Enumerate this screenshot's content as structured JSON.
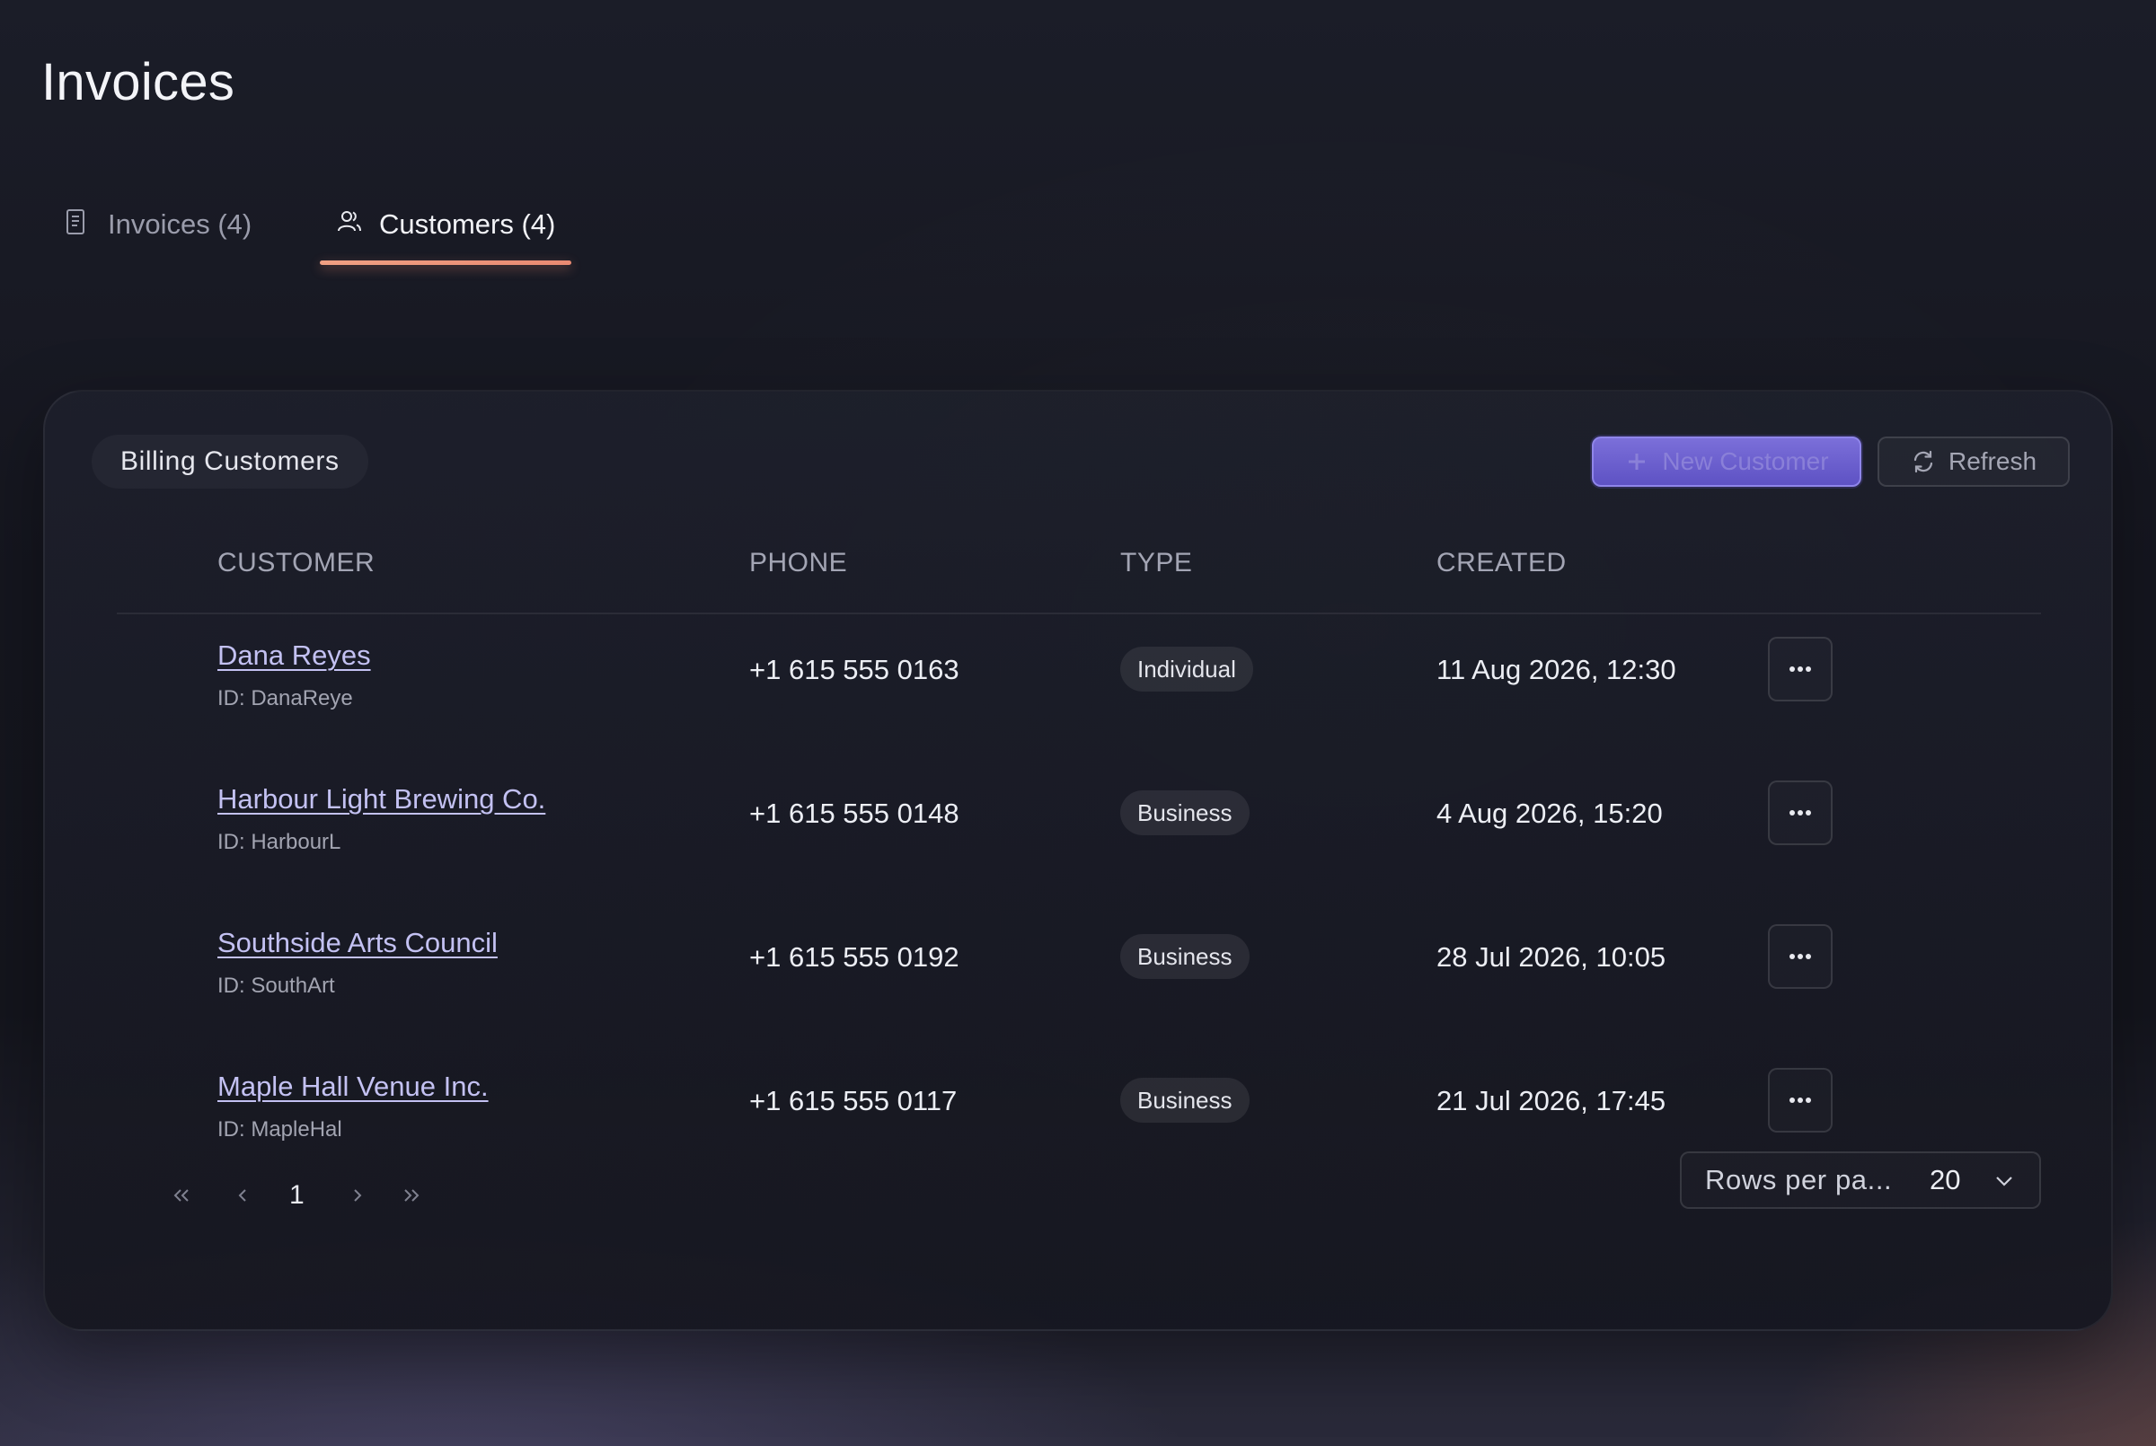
{
  "page": {
    "title": "Invoices"
  },
  "tabs": [
    {
      "label": "Invoices (4)",
      "icon": "document-icon",
      "active": false
    },
    {
      "label": "Customers (4)",
      "icon": "users-icon",
      "active": true
    }
  ],
  "card": {
    "title": "Billing Customers",
    "new_button": "New Customer",
    "refresh_button": "Refresh"
  },
  "table": {
    "columns": [
      "CUSTOMER",
      "PHONE",
      "TYPE",
      "CREATED"
    ],
    "rows": [
      {
        "name": "Dana Reyes",
        "id": "ID: DanaReye",
        "phone": "+1 615 555 0163",
        "type": "Individual",
        "created": "11 Aug 2026, 12:30"
      },
      {
        "name": "Harbour Light Brewing Co.",
        "id": "ID: HarbourL",
        "phone": "+1 615 555 0148",
        "type": "Business",
        "created": "4 Aug 2026, 15:20"
      },
      {
        "name": "Southside Arts Council",
        "id": "ID: SouthArt",
        "phone": "+1 615 555 0192",
        "type": "Business",
        "created": "28 Jul 2026, 10:05"
      },
      {
        "name": "Maple Hall Venue Inc.",
        "id": "ID: MapleHal",
        "phone": "+1 615 555 0117",
        "type": "Business",
        "created": "21 Jul 2026, 17:45"
      }
    ]
  },
  "pagination": {
    "current_page": "1",
    "rows_per_page_label": "Rows per pa...",
    "rows_per_page_value": "20"
  },
  "colors": {
    "accent": "#6a5fd0",
    "tab_underline": "#e98a72",
    "link": "#c3c1f2",
    "background": "#16171f"
  }
}
